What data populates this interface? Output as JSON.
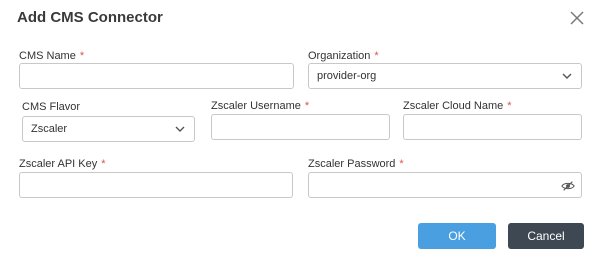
{
  "dialog": {
    "title": "Add CMS Connector",
    "close_icon": "close-icon"
  },
  "fields": {
    "cms_name": {
      "label": "CMS Name",
      "required_mark": "*",
      "value": "",
      "placeholder": ""
    },
    "organization": {
      "label": "Organization",
      "required_mark": "*",
      "selected": "provider-org"
    },
    "cms_flavor": {
      "label": "CMS Flavor",
      "selected": "Zscaler"
    },
    "zscaler_username": {
      "label": "Zscaler Username",
      "required_mark": "*",
      "value": "",
      "placeholder": ""
    },
    "zscaler_cloud_name": {
      "label": "Zscaler Cloud Name",
      "required_mark": "*",
      "value": "",
      "placeholder": ""
    },
    "zscaler_api_key": {
      "label": "Zscaler API Key",
      "required_mark": "*",
      "value": "",
      "placeholder": ""
    },
    "zscaler_password": {
      "label": "Zscaler Password",
      "required_mark": "*",
      "value": "",
      "placeholder": "",
      "toggle_icon": "eye-icon"
    }
  },
  "buttons": {
    "ok_label": "OK",
    "cancel_label": "Cancel"
  },
  "colors": {
    "required": "#d9534f",
    "primary_button": "#4a9fe0",
    "secondary_button": "#3d4852",
    "border": "#c8c8c8"
  }
}
